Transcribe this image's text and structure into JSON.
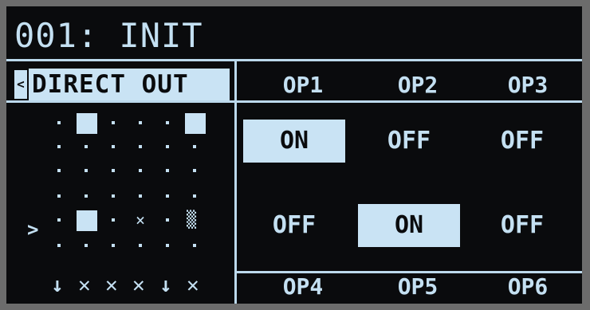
{
  "patch": {
    "title": "001: INIT"
  },
  "mode": {
    "arrow": "<",
    "label": "DIRECT OUT"
  },
  "operators": [
    {
      "label": "OP1",
      "state": "ON"
    },
    {
      "label": "OP2",
      "state": "OFF"
    },
    {
      "label": "OP3",
      "state": "OFF"
    },
    {
      "label": "OP4",
      "state": "OFF"
    },
    {
      "label": "OP5",
      "state": "ON"
    },
    {
      "label": "OP6",
      "state": "OFF"
    }
  ],
  "matrix": {
    "row_marker": ">",
    "bottom_symbols": [
      "↓",
      "✕",
      "✕",
      "✕",
      "↓",
      "✕"
    ]
  },
  "colors": {
    "background": "#0a0b0d",
    "foreground": "#c4e0f2",
    "highlight": "#c9e3f4"
  }
}
